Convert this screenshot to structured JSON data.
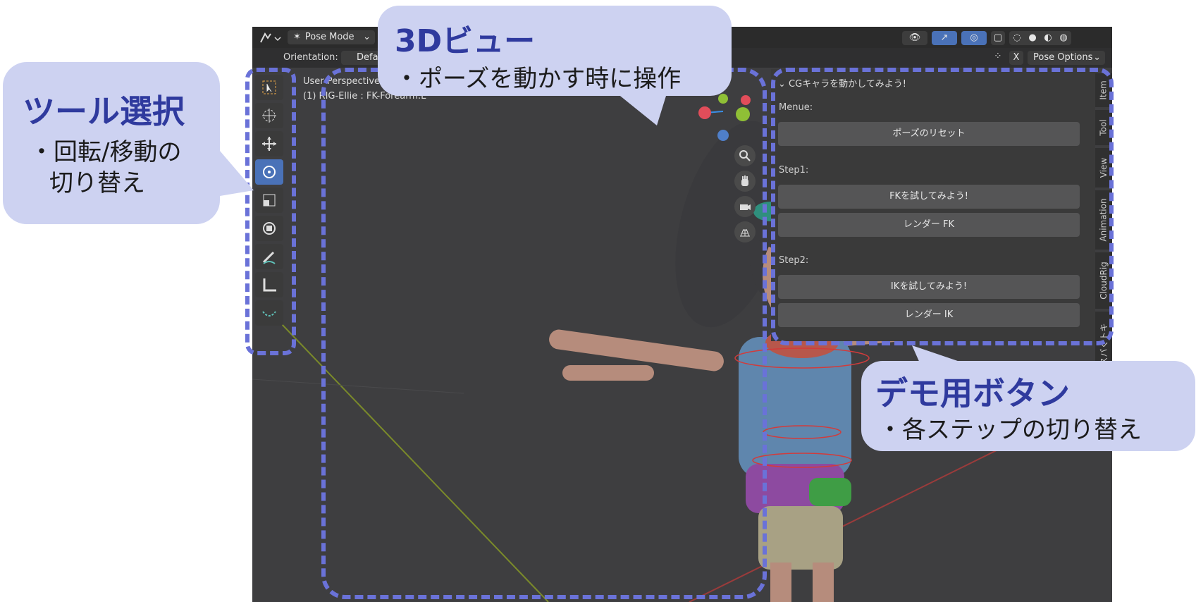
{
  "header": {
    "mode_label": "Pose Mode",
    "orientation_label": "Orientation:",
    "orientation_value": "Defa",
    "x_label": "X",
    "pose_options_label": "Pose Options"
  },
  "viewport": {
    "perspective_label": "User Perspective",
    "object_label": "(1) RIG-Ellie : FK-Forearm.L"
  },
  "tools": [
    "select-box",
    "cursor",
    "move",
    "rotate",
    "scale",
    "transform",
    "annotate",
    "measure",
    "curve"
  ],
  "panel": {
    "title": "CGキャラを動かしてみよう!",
    "menu_label": "Menue:",
    "reset_button": "ポーズのリセット",
    "step1_label": "Step1:",
    "fk_try_button": "FKを試してみよう!",
    "fk_render_button": "レンダー FK",
    "step2_label": "Step2:",
    "ik_try_button": "IKを試してみよう!",
    "ik_render_button": "レンダー IK"
  },
  "side_tabs": [
    "Item",
    "Tool",
    "View",
    "Animation",
    "CloudRig",
    "スバくトキ"
  ],
  "callouts": {
    "tools": {
      "title": "ツール選択",
      "line1": "・回転/移動の",
      "line2": "切り替え"
    },
    "view3d": {
      "title": "3Dビュー",
      "line1": "・ポーズを動かす時に操作"
    },
    "demo": {
      "title": "デモ用ボタン",
      "line1": "・各ステップの切り替え"
    }
  },
  "colors": {
    "accent_dash": "#6a72d8",
    "callout_bg": "#cdd2f1",
    "callout_title": "#2f3a9e",
    "active_tool": "#4a72b8"
  }
}
